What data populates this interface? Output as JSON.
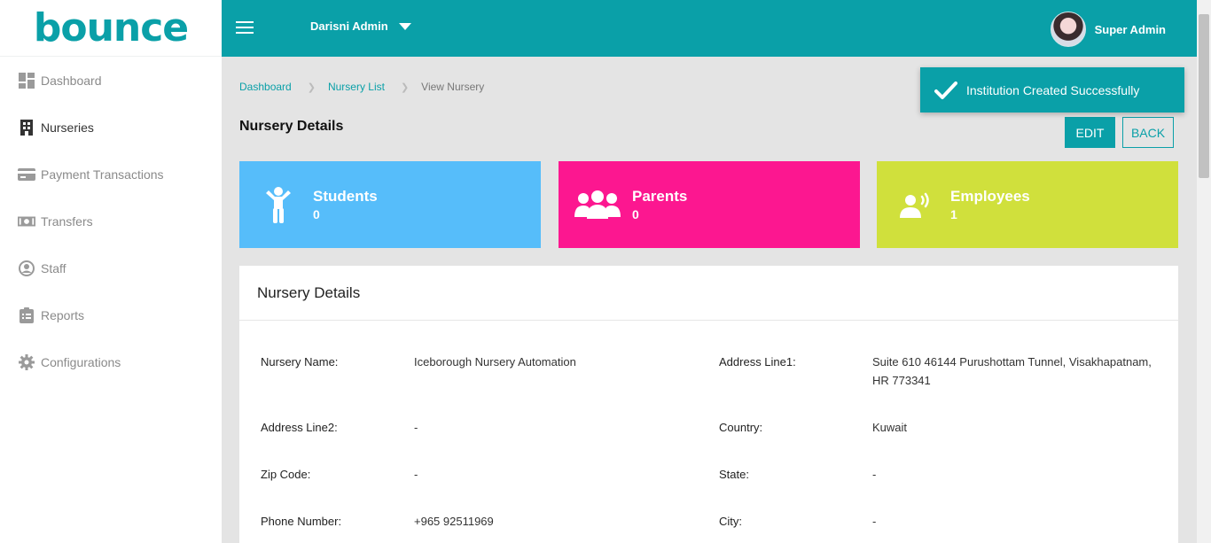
{
  "logo": {
    "text": "bounce"
  },
  "sidebar": {
    "items": [
      {
        "label": "Dashboard",
        "icon": "dashboard-icon"
      },
      {
        "label": "Nurseries",
        "icon": "building-icon"
      },
      {
        "label": "Payment Transactions",
        "icon": "credit-card-icon"
      },
      {
        "label": "Transfers",
        "icon": "money-bill-icon"
      },
      {
        "label": "Staff",
        "icon": "user-circle-icon"
      },
      {
        "label": "Reports",
        "icon": "clipboard-icon"
      },
      {
        "label": "Configurations",
        "icon": "gear-icon"
      }
    ],
    "active": "Nurseries"
  },
  "header": {
    "admin_selector": "Darisni Admin",
    "user_name": "Super Admin"
  },
  "breadcrumb": {
    "items": [
      "Dashboard",
      "Nursery List"
    ],
    "current": "View Nursery"
  },
  "page": {
    "title": "Nursery Details",
    "edit_label": "EDIT",
    "back_label": "BACK"
  },
  "toast": {
    "message": "Institution Created Successfully"
  },
  "stats": {
    "students": {
      "label": "Students",
      "count": "0",
      "color": "#56bdfa"
    },
    "parents": {
      "label": "Parents",
      "count": "0",
      "color": "#fc1790"
    },
    "employees": {
      "label": "Employees",
      "count": "1",
      "color": "#d0e03c"
    }
  },
  "details": {
    "title": "Nursery Details",
    "nursery_name": {
      "label": "Nursery Name:",
      "value": "Iceborough Nursery Automation"
    },
    "address_line1": {
      "label": "Address Line1:",
      "value": "Suite 610 46144 Purushottam Tunnel, Visakhapatnam, HR 773341"
    },
    "address_line2": {
      "label": "Address Line2:",
      "value": "-"
    },
    "country": {
      "label": "Country:",
      "value": "Kuwait"
    },
    "zip_code": {
      "label": "Zip Code:",
      "value": "-"
    },
    "state": {
      "label": "State:",
      "value": "-"
    },
    "phone_number": {
      "label": "Phone Number:",
      "value": "+965 92511969"
    },
    "city": {
      "label": "City:",
      "value": "-"
    }
  },
  "colors": {
    "primary": "#0aa0a8",
    "accent_dot": "#b8d433",
    "background": "#e4e4e4"
  }
}
